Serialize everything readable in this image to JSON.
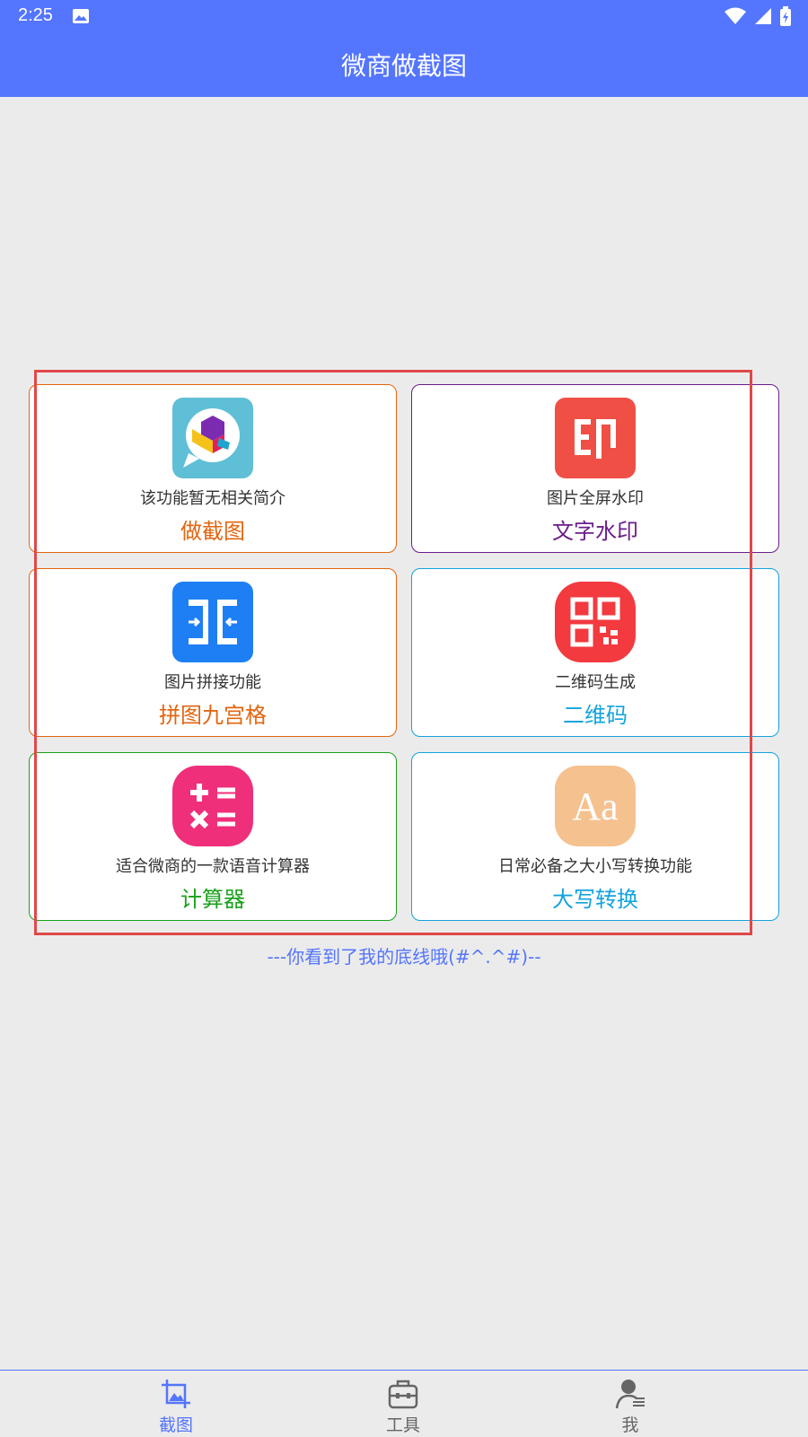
{
  "status_bar": {
    "time": "2:25"
  },
  "app_bar": {
    "title": "微商做截图"
  },
  "colors": {
    "primary": "#5475fd",
    "orange": "#e3650f",
    "purple": "#6b1d8a",
    "sky": "#13a3dd",
    "green": "#19a21a",
    "highlight": "#e04848"
  },
  "cards": [
    {
      "title": "做截图",
      "desc": "该功能暂无相关简介",
      "icon": "screenshot-app-icon"
    },
    {
      "title": "文字水印",
      "desc": "图片全屏水印",
      "icon": "watermark-stamp-icon"
    },
    {
      "title": "拼图九宫格",
      "desc": "图片拼接功能",
      "icon": "image-merge-icon"
    },
    {
      "title": "二维码",
      "desc": "二维码生成",
      "icon": "qr-code-icon"
    },
    {
      "title": "计算器",
      "desc": "适合微商的一款语音计算器",
      "icon": "calculator-icon"
    },
    {
      "title": "大写转换",
      "desc": "日常必备之大小写转换功能",
      "icon": "text-case-icon"
    }
  ],
  "footer_note": "---你看到了我的底线哦(#^.^#)--",
  "bottom_nav": [
    {
      "label": "截图",
      "icon": "crop-image-icon",
      "active": true
    },
    {
      "label": "工具",
      "icon": "toolbox-icon",
      "active": false
    },
    {
      "label": "我",
      "icon": "profile-icon",
      "active": false
    }
  ]
}
